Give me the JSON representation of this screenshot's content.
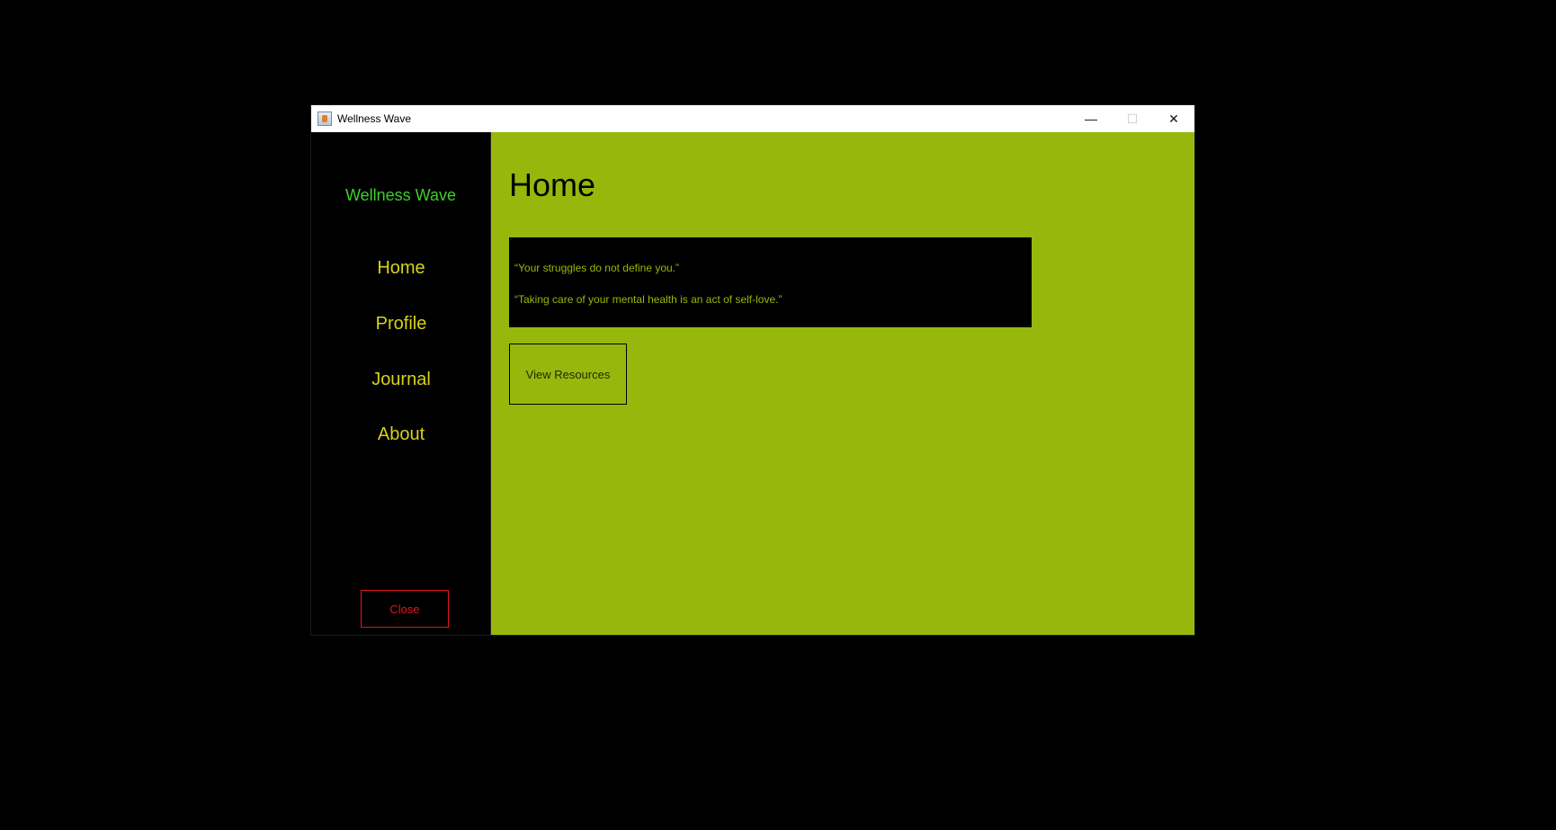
{
  "window": {
    "title": "Wellness Wave",
    "controls": {
      "minimize": "—",
      "maximize": "☐",
      "close": "✕"
    }
  },
  "sidebar": {
    "brand": "Wellness Wave",
    "items": [
      {
        "label": "Home"
      },
      {
        "label": "Profile"
      },
      {
        "label": "Journal"
      },
      {
        "label": "About"
      }
    ],
    "close_label": "Close"
  },
  "main": {
    "title": "Home",
    "quotes": [
      "“Your struggles do not define you.”",
      "“Taking care of your mental health is an act of self-love.”"
    ],
    "resources_label": "View Resources"
  },
  "colors": {
    "accent_green": "#97b70d",
    "nav_yellow": "#d6d21b",
    "brand_green": "#3fcf2a",
    "close_red": "#e0151b",
    "background": "#000000"
  }
}
